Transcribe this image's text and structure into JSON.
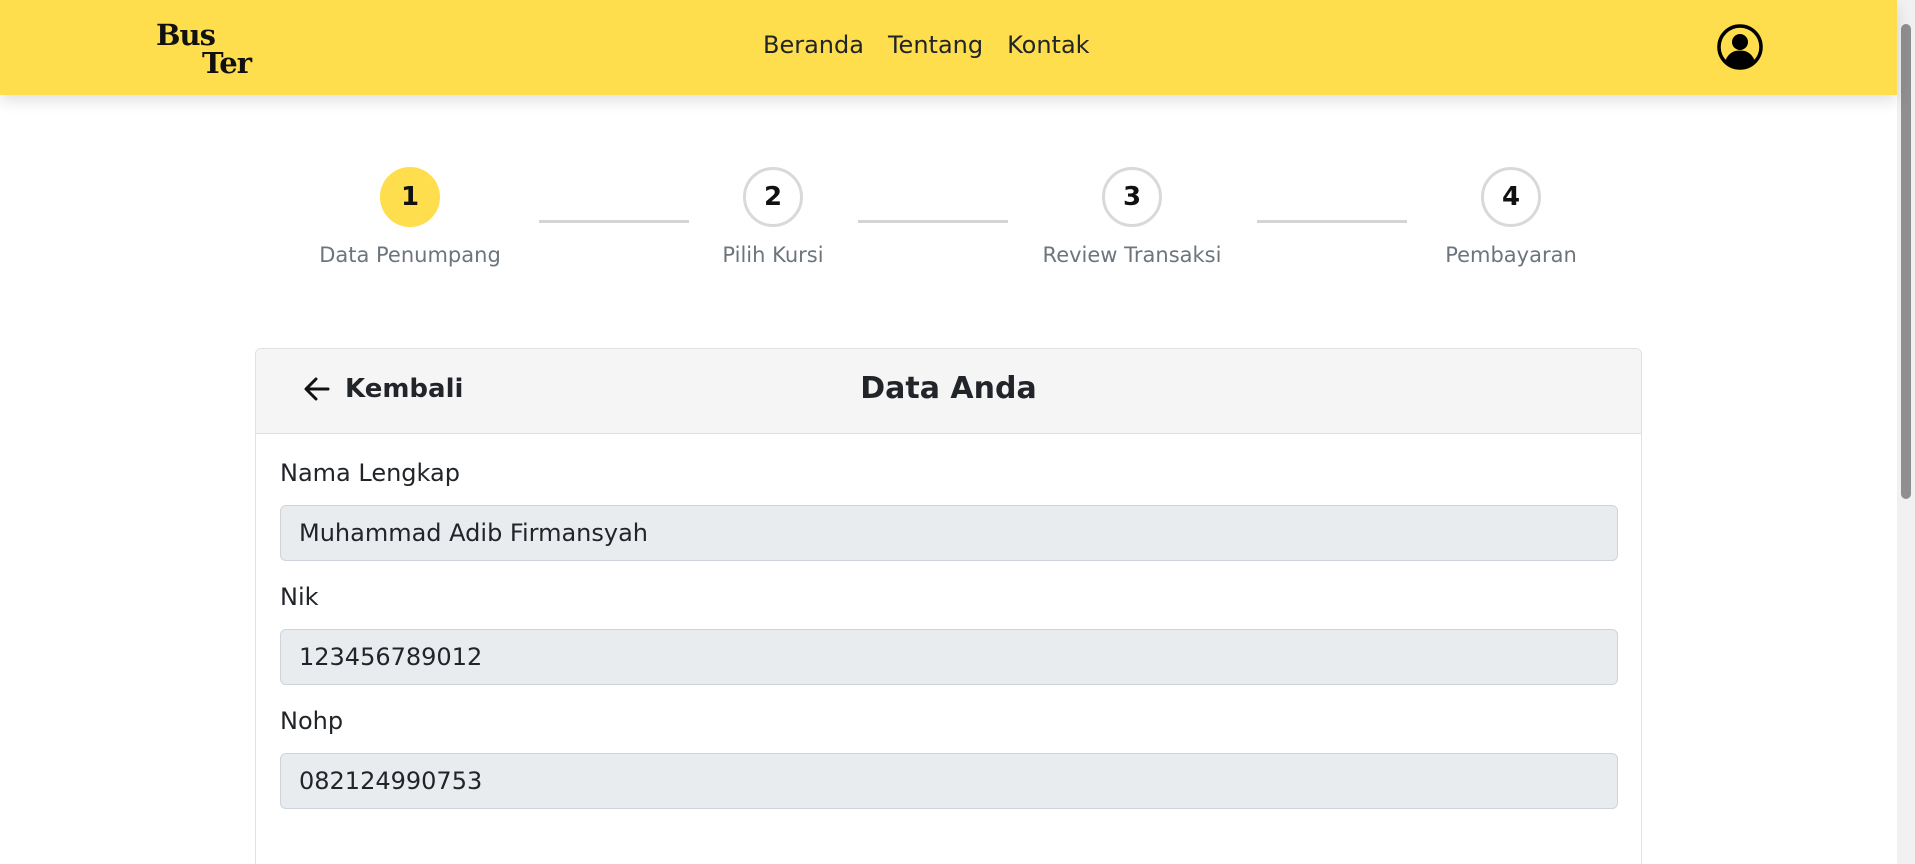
{
  "header": {
    "logo_line1": "Bus",
    "logo_line2": "Ter",
    "nav": [
      "Beranda",
      "Tentang",
      "Kontak"
    ]
  },
  "stepper": {
    "steps": [
      {
        "number": "1",
        "label": "Data Penumpang",
        "active": true
      },
      {
        "number": "2",
        "label": "Pilih Kursi",
        "active": false
      },
      {
        "number": "3",
        "label": "Review Transaksi",
        "active": false
      },
      {
        "number": "4",
        "label": "Pembayaran",
        "active": false
      }
    ]
  },
  "card": {
    "back_label": "Kembali",
    "title": "Data Anda",
    "fields": [
      {
        "label": "Nama Lengkap",
        "value": "Muhammad Adib Firmansyah"
      },
      {
        "label": "Nik",
        "value": "123456789012"
      },
      {
        "label": "Nohp",
        "value": "082124990753"
      }
    ]
  },
  "colors": {
    "accent": "#ffde4d",
    "input_bg": "#e9ecef",
    "muted_text": "#6c757d"
  },
  "icons": {
    "back": "arrow-left-icon",
    "profile": "user-circle-icon"
  }
}
